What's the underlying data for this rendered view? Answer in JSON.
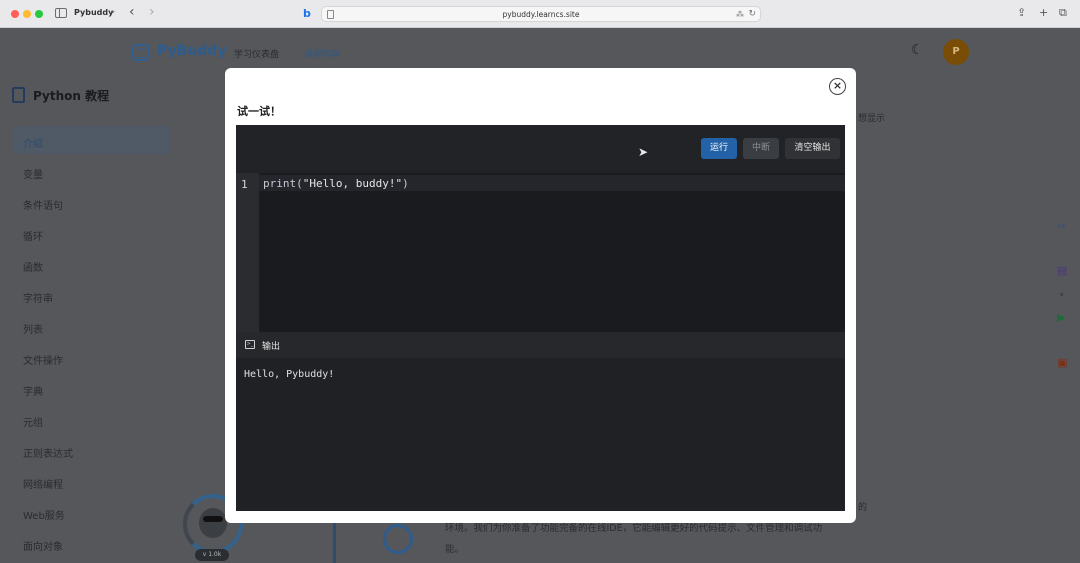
{
  "browser": {
    "tab_group": "Pybuddy",
    "url": "pybuddy.learncs.site"
  },
  "header": {
    "brand": "PyBuddy",
    "nav": [
      "学习仪表盘",
      "课程内容"
    ],
    "avatar_initial": "P"
  },
  "sidebar": {
    "title": "Python 教程",
    "items": [
      "介绍",
      "变量",
      "条件语句",
      "循环",
      "函数",
      "字符串",
      "列表",
      "文件操作",
      "字典",
      "元组",
      "正则表达式",
      "网络编程",
      "Web服务",
      "面向对象"
    ],
    "active_index": 0
  },
  "content": {
    "fragment_right": "想显示",
    "bottom_line1": "的",
    "bottom_line2": "环境。我们为你准备了功能完备的在线IDE，它能编辑更好的代码提示、文件管理和调试功",
    "bottom_line3": "能。",
    "mascot_badge": "v 1.0k"
  },
  "modal": {
    "title": "试一试！",
    "close_glyph": "×",
    "buttons": {
      "run": "运行",
      "stop": "中断",
      "clear": "清空输出"
    },
    "editor": {
      "line_number": "1",
      "code_fn": "print(",
      "code_str": "\"Hello, buddy!\"",
      "code_end": ")"
    },
    "output": {
      "label": "输出",
      "text": "Hello, Pybuddy!"
    }
  },
  "colors": {
    "run_button": "#2462a8",
    "brand": "#2c5c90",
    "avatar": "#7a4d07"
  },
  "icons": [
    "sidebar-toggle-icon",
    "bing-icon",
    "page-icon",
    "reload-icon",
    "share-icon",
    "new-tab-icon",
    "tabs-icon",
    "logo-icon",
    "moon-icon",
    "book-icon",
    "close-icon",
    "terminal-icon",
    "code-icon"
  ]
}
